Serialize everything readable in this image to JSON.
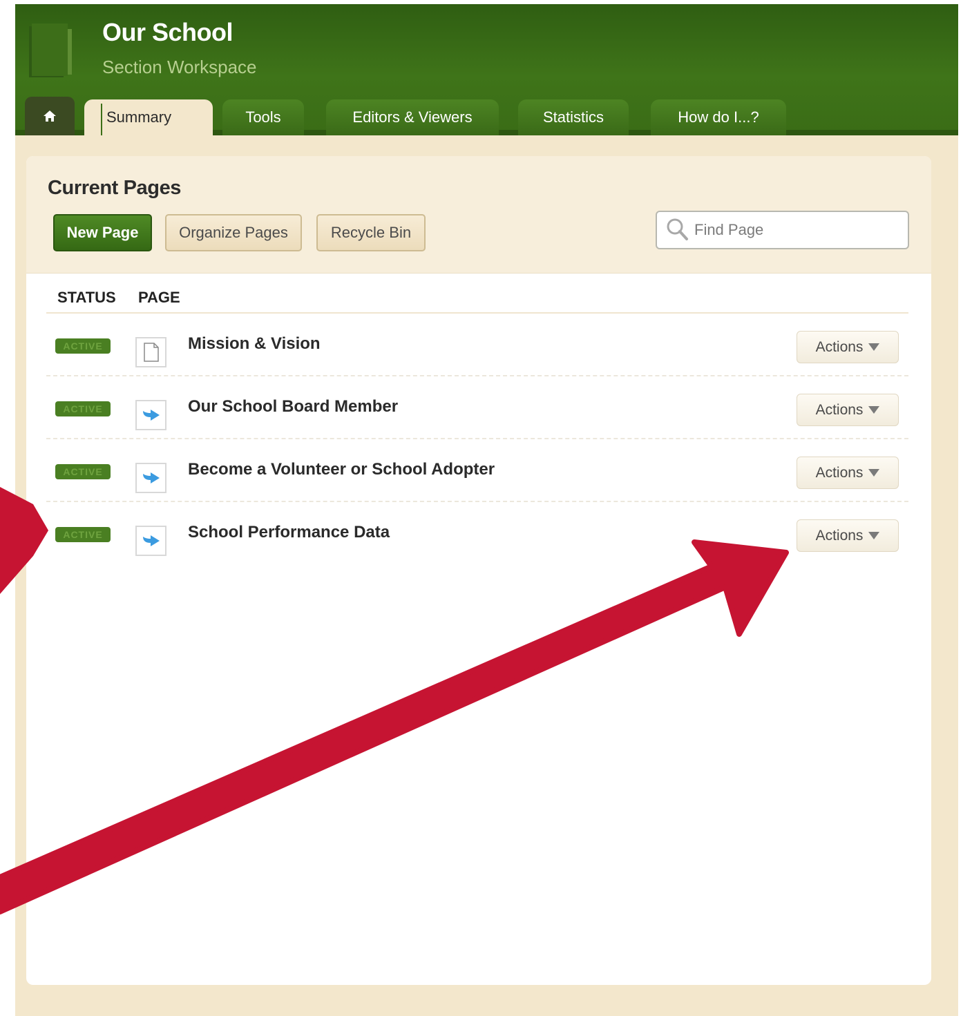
{
  "header": {
    "title": "Our School",
    "subtitle": "Section Workspace"
  },
  "tabs": [
    {
      "label": "Summary"
    },
    {
      "label": "Tools"
    },
    {
      "label": "Editors & Viewers"
    },
    {
      "label": "Statistics"
    },
    {
      "label": "How do I...?"
    }
  ],
  "main": {
    "title": "Current Pages",
    "buttons": {
      "new_page": "New Page",
      "organize_pages": "Organize Pages",
      "recycle_bin": "Recycle Bin"
    },
    "search": {
      "placeholder": "Find Page"
    },
    "columns": {
      "status": "STATUS",
      "page": "PAGE"
    },
    "rows": [
      {
        "status": "ACTIVE",
        "icon": "document-icon",
        "title": "Mission & Vision",
        "action": "Actions"
      },
      {
        "status": "ACTIVE",
        "icon": "link-arrow-icon",
        "title": "Our School Board Member",
        "action": "Actions"
      },
      {
        "status": "ACTIVE",
        "icon": "link-arrow-icon",
        "title": "Become a Volunteer or School Adopter",
        "action": "Actions"
      },
      {
        "status": "ACTIVE",
        "icon": "link-arrow-icon",
        "title": "School Performance Data",
        "action": "Actions"
      }
    ]
  },
  "colors": {
    "header_green": "#3f7419",
    "accent_red": "#c61432",
    "panel_tan": "#f3e7cc"
  }
}
